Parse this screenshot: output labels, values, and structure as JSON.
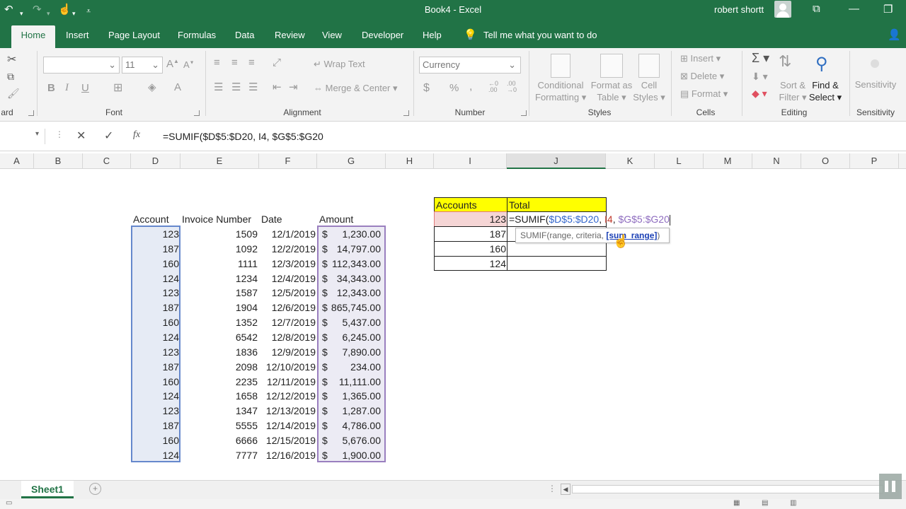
{
  "title_bar": {
    "doc_title": "Book4  -  Excel",
    "user_name": "robert shortt"
  },
  "tabs": [
    "Home",
    "Insert",
    "Page Layout",
    "Formulas",
    "Data",
    "Review",
    "View",
    "Developer",
    "Help"
  ],
  "tell_me": "Tell me what you want to do",
  "ribbon": {
    "clipboard_label": "ard",
    "font": {
      "size": "11",
      "label": "Font",
      "bold": "B",
      "italic": "I",
      "underline": "U"
    },
    "alignment": {
      "wrap_text": "Wrap Text",
      "merge_center": "Merge & Center",
      "label": "Alignment"
    },
    "number": {
      "format": "Currency",
      "currency": "$",
      "percent": "%",
      "comma": ",",
      "label": "Number"
    },
    "styles": {
      "conditional1": "Conditional",
      "conditional2": "Formatting",
      "format_as1": "Format as",
      "format_as2": "Table",
      "cell1": "Cell",
      "cell2": "Styles",
      "label": "Styles"
    },
    "cells": {
      "insert": "Insert",
      "delete": "Delete",
      "format": "Format",
      "label": "Cells"
    },
    "editing": {
      "sort1": "Sort &",
      "sort2": "Filter",
      "find1": "Find &",
      "find2": "Select",
      "label": "Editing"
    },
    "sensitivity": {
      "button": "Sensitivity",
      "label": "Sensitivity"
    }
  },
  "formula_bar": {
    "cancel": "✕",
    "enter": "✓",
    "fx": "fx",
    "formula": "=SUMIF($D$5:$D20, I4, $G$5:$G20"
  },
  "columns": [
    "A",
    "B",
    "C",
    "D",
    "E",
    "F",
    "G",
    "H",
    "I",
    "J",
    "K",
    "L",
    "M",
    "N",
    "O",
    "P"
  ],
  "table": {
    "headers": {
      "account": "Account",
      "invoice": "Invoice Number",
      "date": "Date",
      "amount": "Amount"
    },
    "rows": [
      {
        "account": "123",
        "invoice": "1509",
        "date": "12/1/2019",
        "cur": "$",
        "amount": "1,230.00"
      },
      {
        "account": "187",
        "invoice": "1092",
        "date": "12/2/2019",
        "cur": "$",
        "amount": "14,797.00"
      },
      {
        "account": "160",
        "invoice": "1111",
        "date": "12/3/2019",
        "cur": "$",
        "amount": "112,343.00"
      },
      {
        "account": "124",
        "invoice": "1234",
        "date": "12/4/2019",
        "cur": "$",
        "amount": "34,343.00"
      },
      {
        "account": "123",
        "invoice": "1587",
        "date": "12/5/2019",
        "cur": "$",
        "amount": "12,343.00"
      },
      {
        "account": "187",
        "invoice": "1904",
        "date": "12/6/2019",
        "cur": "$",
        "amount": "865,745.00"
      },
      {
        "account": "160",
        "invoice": "1352",
        "date": "12/7/2019",
        "cur": "$",
        "amount": "5,437.00"
      },
      {
        "account": "124",
        "invoice": "6542",
        "date": "12/8/2019",
        "cur": "$",
        "amount": "6,245.00"
      },
      {
        "account": "123",
        "invoice": "1836",
        "date": "12/9/2019",
        "cur": "$",
        "amount": "7,890.00"
      },
      {
        "account": "187",
        "invoice": "2098",
        "date": "12/10/2019",
        "cur": "$",
        "amount": "234.00"
      },
      {
        "account": "160",
        "invoice": "2235",
        "date": "12/11/2019",
        "cur": "$",
        "amount": "11,111.00"
      },
      {
        "account": "124",
        "invoice": "1658",
        "date": "12/12/2019",
        "cur": "$",
        "amount": "1,365.00"
      },
      {
        "account": "123",
        "invoice": "1347",
        "date": "12/13/2019",
        "cur": "$",
        "amount": "1,287.00"
      },
      {
        "account": "187",
        "invoice": "5555",
        "date": "12/14/2019",
        "cur": "$",
        "amount": "4,786.00"
      },
      {
        "account": "160",
        "invoice": "6666",
        "date": "12/15/2019",
        "cur": "$",
        "amount": "5,676.00"
      },
      {
        "account": "124",
        "invoice": "7777",
        "date": "12/16/2019",
        "cur": "$",
        "amount": "1,900.00"
      }
    ]
  },
  "summary": {
    "headers": {
      "accounts": "Accounts",
      "total": "Total"
    },
    "accounts": [
      "123",
      "187",
      "160",
      "124"
    ],
    "editing_formula": {
      "prefix": "=SUMIF(",
      "range": "$D$5:$D20",
      "sep1": ", ",
      "criteria": "I4",
      "sep2": ", ",
      "sum_range": "$G$5:$G20"
    },
    "tooltip": {
      "text": "SUMIF(range, criteria, ",
      "bold": "[sum_range]",
      "close": ")"
    }
  },
  "sheets": [
    "Sheet1"
  ],
  "colors": {
    "excel_green": "#217346",
    "range_blue": "#3366cc",
    "criteria_red": "#c0392b",
    "sum_purple": "#8e6cbf",
    "highlight_yellow": "#ffff00"
  }
}
